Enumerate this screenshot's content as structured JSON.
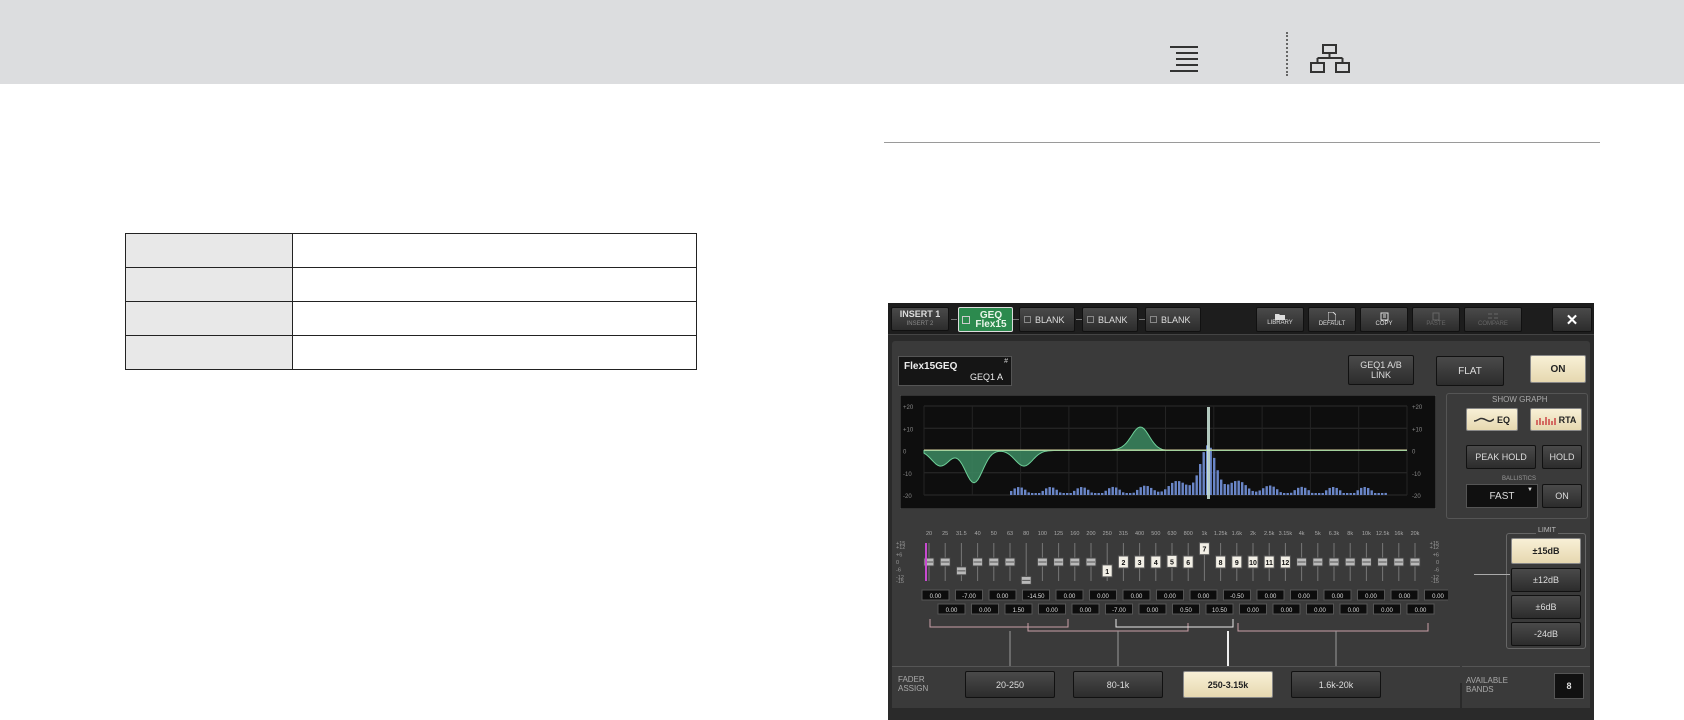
{
  "panel": {
    "insert": {
      "active": "INSERT 1",
      "inactive": "INSERT 2"
    },
    "slots": [
      {
        "label_line1": "GEQ",
        "label_line2": "Flex15",
        "active": true
      },
      {
        "label": "BLANK"
      },
      {
        "label": "BLANK"
      },
      {
        "label": "BLANK"
      }
    ],
    "toolbar": [
      {
        "label": "LIBRARY",
        "icon": "folder-icon",
        "enabled": true
      },
      {
        "label": "DEFAULT",
        "icon": "document-icon",
        "enabled": true
      },
      {
        "label": "COPY",
        "icon": "copy-icon",
        "enabled": true
      },
      {
        "label": "PASTE",
        "icon": "paste-icon",
        "enabled": false
      },
      {
        "label": "COMPARE",
        "icon": "compare-icon",
        "enabled": false
      }
    ],
    "close_symbol": "✕",
    "rack": {
      "name": "Flex15GEQ",
      "unit": "GEQ1 A",
      "marker": "#"
    },
    "link_button": {
      "line1": "GEQ1 A/B",
      "line2": "LINK"
    },
    "flat_button": "FLAT",
    "on_button": "ON",
    "show_graph": {
      "title": "SHOW GRAPH",
      "eq": "EQ",
      "rta": "RTA"
    },
    "peak_hold": "PEAK HOLD",
    "hold": "HOLD",
    "ballistics": {
      "title": "BALLISTICS",
      "value": "FAST",
      "on": "ON"
    },
    "graph": {
      "y_ticks_left": [
        "+20",
        "+10",
        "0",
        "-10",
        "-20"
      ],
      "y_ticks_right": [
        "+20",
        "+10",
        "0",
        "-10",
        "-20"
      ],
      "eq_gain_by_band": [
        0,
        -7,
        0,
        -14.5,
        0,
        0,
        -7,
        0,
        0,
        0,
        0,
        0,
        0.5,
        10.5,
        0,
        0,
        0,
        0,
        0,
        0,
        0,
        0,
        0,
        0,
        0,
        0,
        0,
        0,
        0,
        0
      ]
    },
    "freq_labels": [
      "20",
      "25",
      "31.5",
      "40",
      "50",
      "63",
      "80",
      "100",
      "125",
      "160",
      "200",
      "250",
      "315",
      "400",
      "500",
      "630",
      "800",
      "1k",
      "1.25k",
      "1.6k",
      "2k",
      "2.5k",
      "3.15k",
      "4k",
      "5k",
      "6.3k",
      "8k",
      "10k",
      "12.5k",
      "16k",
      "20k"
    ],
    "fader_scale": [
      "+15",
      "+12",
      "+6",
      "0",
      "-6",
      "-12",
      "-15"
    ],
    "fader_gains": [
      0,
      0,
      -7,
      0,
      0,
      0,
      -14.5,
      0,
      0,
      0,
      0,
      -7,
      0,
      0,
      0,
      0.5,
      0,
      10.5,
      0,
      0,
      0,
      0,
      0,
      0,
      0,
      0,
      0,
      0,
      0,
      0,
      0
    ],
    "band_numbers": {
      "6": "",
      "11": "1",
      "12": "2",
      "13": "3",
      "14": "4",
      "15": "5",
      "16": "6",
      "17": "7",
      "18": "8",
      "19": "9",
      "20": "10",
      "21": "11",
      "22": "12"
    },
    "values_row1": [
      "0.00",
      "-7.00",
      "0.00",
      "-14.50",
      "0.00",
      "0.00",
      "0.00",
      "0.00",
      "0.00",
      "-0.50",
      "0.00",
      "0.00",
      "0.00",
      "0.00",
      "0.00",
      "0.00"
    ],
    "values_row2": [
      "0.00",
      "0.00",
      "1.50",
      "0.00",
      "0.00",
      "-7.00",
      "0.00",
      "0.50",
      "10.50",
      "0.00",
      "0.00",
      "0.00",
      "0.00",
      "0.00",
      "0.00"
    ],
    "limit": {
      "title": "LIMIT",
      "options": [
        "±15dB",
        "±12dB",
        "±6dB",
        "-24dB"
      ],
      "selected": 0
    },
    "fader_assign": {
      "label_line1": "FADER",
      "label_line2": "ASSIGN",
      "ranges": [
        "20-250",
        "80-1k",
        "250-3.15k",
        "1.6k-20k"
      ],
      "selected": 2
    },
    "available_bands": {
      "label_line1": "AVAILABLE",
      "label_line2": "BANDS",
      "value": "8"
    }
  }
}
